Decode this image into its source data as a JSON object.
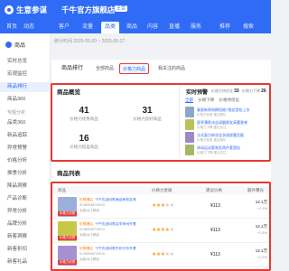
{
  "app": {
    "name": "生意参谋",
    "shop_name": "千牛官方旗舰店",
    "shop_badge": "主营"
  },
  "nav": [
    "首页",
    "动态",
    "客户",
    "流量",
    "品类",
    "商品",
    "内容",
    "直播",
    "服务",
    "推荐",
    "搜索"
  ],
  "nav_active": "品类",
  "sidebar": {
    "header": "商品",
    "items": [
      {
        "label": "实时总览",
        "active": false
      },
      {
        "label": "宏观监控",
        "active": false
      },
      {
        "label": "商品排行",
        "active": true
      },
      {
        "label": "商品360",
        "active": false
      }
    ],
    "group": "专题分析",
    "items2": [
      {
        "label": "品类360",
        "active": false
      },
      {
        "label": "新品追踪",
        "active": false
      },
      {
        "label": "异常预警",
        "active": false
      },
      {
        "label": "价格分析",
        "active": false
      },
      {
        "label": "换季分析",
        "active": false
      },
      {
        "label": "降品洞察",
        "active": false
      },
      {
        "label": "产品诊断",
        "active": false
      },
      {
        "label": "异常分析",
        "active": false
      },
      {
        "label": "品牌分析",
        "active": false
      },
      {
        "label": "新客洞察",
        "active": false
      },
      {
        "label": "新客折扣",
        "active": false
      },
      {
        "label": "新客礼品",
        "active": false
      }
    ]
  },
  "datebar": "统计时间 2025-05-20 ~ 2025-05-27",
  "tabs": [
    {
      "label": "商品排行",
      "active": false
    },
    {
      "label": "全部商品",
      "active": false
    },
    {
      "label": "价格力商品",
      "active": true
    },
    {
      "label": "我关注的商品",
      "active": false
    }
  ],
  "overview": {
    "title": "商品概览",
    "metrics": [
      {
        "value": "41",
        "label": "价格力优秀商品"
      },
      {
        "value": "31",
        "label": "价格力良好商品"
      },
      {
        "value": "16",
        "label": "价格力较差商品"
      }
    ]
  },
  "alerts": {
    "title": "实时预警",
    "meta1_label": "价格力待优化",
    "meta1_value": "33",
    "meta2_label": "价格力下降",
    "meta2_value": "26",
    "tabs": [
      "全部",
      "价格下降",
      "价格待优化"
    ],
    "items": [
      {
        "text": "春夏新款纯棉短袖T恤女宽松上衣",
        "sub": "价格力较差 建议降价"
      },
      {
        "text": "夏季薄款冰丝阔腿裤女高腰垂感",
        "sub": "价格力下降 建议关注"
      },
      {
        "text": "法式复古碎花连衣裙收腰显瘦",
        "sub": "价格力较差 建议降价"
      },
      {
        "text": "休闲运动套装女两件套宽松",
        "sub": "价格力下降 建议关注"
      }
    ]
  },
  "list": {
    "title": "商品列表",
    "headers": [
      "商品",
      "价格力星级",
      "建议价格",
      "额外曝光"
    ],
    "rows": [
      {
        "tag": "价格力优秀",
        "hot": "价格爆品",
        "name": "千牛优选同款春夏新款女装",
        "id": "ID:365948729013",
        "cat": "女装/女士精品",
        "stars": 3,
        "price": "¥113",
        "num": "12.1万",
        "num2": "+2.3%",
        "color": "#9bb0d8"
      },
      {
        "tag": "价格力优秀",
        "hot": "价格爆品",
        "name": "千牛优选同款夏季休闲外套",
        "id": "ID:365948729014",
        "cat": "女装/女士精品",
        "stars": 4,
        "price": "¥113",
        "num": "12.1万",
        "num2": "+1.8%",
        "color": "#c7c84a"
      },
      {
        "tag": "价格力优秀",
        "hot": "价格爆品",
        "name": "千牛优选同款针织开衫外套",
        "id": "ID:365948729015",
        "cat": "女装/女士精品",
        "stars": 3,
        "price": "¥113",
        "num": "12.1万",
        "num2": "+1.2%",
        "color": "#a88fd0"
      }
    ]
  },
  "colors": {
    "primary": "#2f6bf5",
    "highlight": "#e53935",
    "star": "#f5a623"
  }
}
